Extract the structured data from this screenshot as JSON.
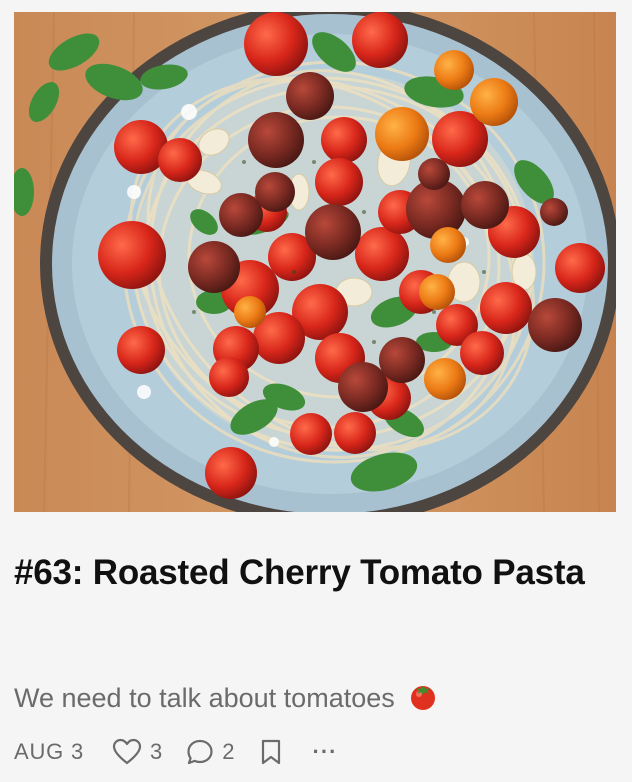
{
  "post": {
    "title": "#63: Roasted Cherry Tomato Pasta",
    "subtitle": "We need to talk about tomatoes",
    "date": "AUG 3",
    "likes": "3",
    "comments": "2",
    "more_label": "···"
  },
  "icons": {
    "emoji": "tomato-emoji",
    "like": "heart-icon",
    "comment": "comment-bubble-icon",
    "bookmark": "bookmark-icon",
    "more": "more-dots-icon"
  },
  "colors": {
    "title": "#111111",
    "muted": "#6b6b6b",
    "background": "#f5f5f6"
  }
}
